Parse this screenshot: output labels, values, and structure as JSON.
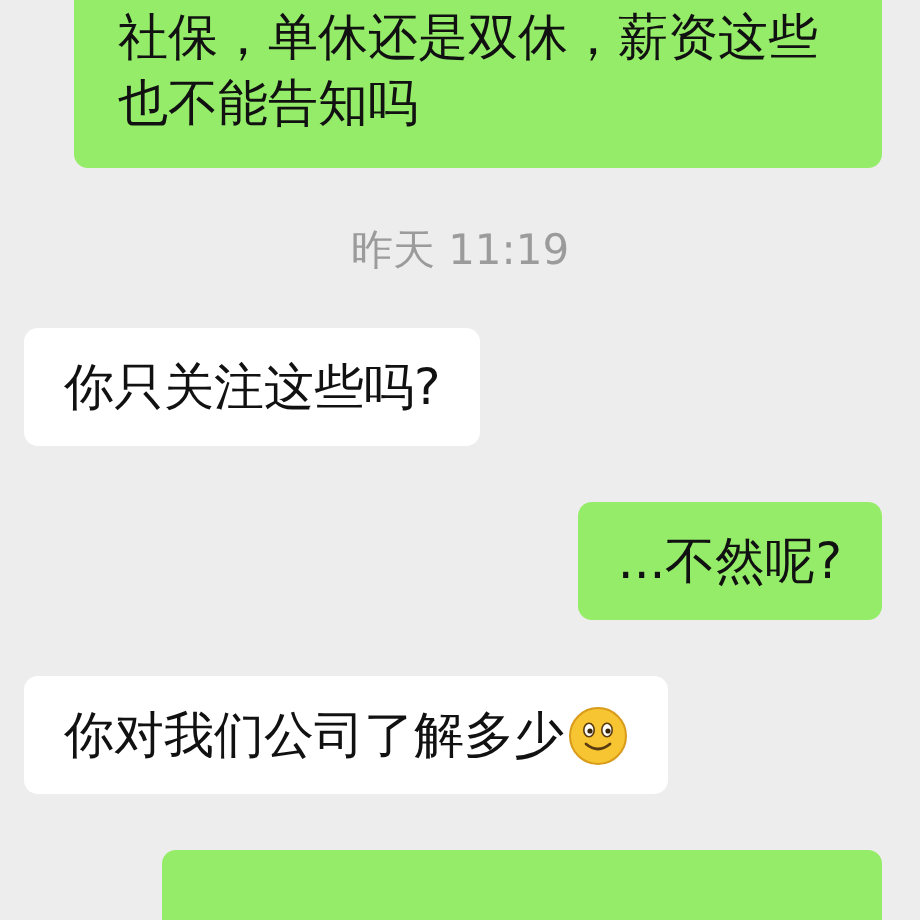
{
  "messages": [
    {
      "kind": "bubble",
      "from_me": true,
      "text": "社保，单休还是双休，薪资这些也不能告知吗"
    },
    {
      "kind": "time",
      "text": "昨天 11:19"
    },
    {
      "kind": "bubble",
      "from_me": false,
      "text": "你只关注这些吗?"
    },
    {
      "kind": "bubble",
      "from_me": true,
      "text": "...不然呢?"
    },
    {
      "kind": "bubble",
      "from_me": false,
      "text": "你对我们公司了解多少",
      "emoji": true
    },
    {
      "kind": "bubble",
      "from_me": true
    }
  ]
}
